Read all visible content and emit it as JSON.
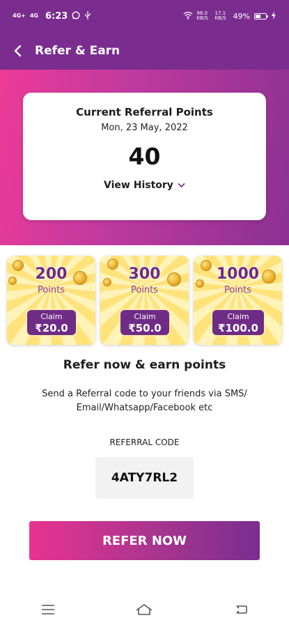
{
  "status_bar": {
    "network_1": "4G+",
    "network_2": "4G",
    "time": "6:23",
    "left_icons": [
      "whatsapp-icon",
      "usb-icon"
    ],
    "right_icons": [
      "wifi-icon"
    ],
    "speed_1": "96.0 KB/S",
    "speed_2": "17.1 KB/S",
    "battery": "49%"
  },
  "app_bar": {
    "title": "Refer & Earn",
    "back_icon": "chevron-left-icon"
  },
  "points_card": {
    "heading": "Current Referral Points",
    "date": "Mon, 23 May, 2022",
    "points": "40",
    "view_history": "View History",
    "accent": "#7a2d8f"
  },
  "rewards": [
    {
      "points": "200",
      "points_label": "Points",
      "claim_label": "Claim",
      "claim_amount": "₹20.0"
    },
    {
      "points": "300",
      "points_label": "Points",
      "claim_label": "Claim",
      "claim_amount": "₹50.0"
    },
    {
      "points": "1000",
      "points_label": "Points",
      "claim_label": "Claim",
      "claim_amount": "₹100.0"
    }
  ],
  "refer": {
    "title": "Refer now & earn points",
    "description": "Send a Referral code to your friends via SMS/ Email/Whatsapp/Facebook etc",
    "code_label": "REFERRAL CODE",
    "code": "4ATY7RL2",
    "button": "REFER NOW"
  },
  "nav_bar": [
    "menu-icon",
    "home-icon",
    "back-icon"
  ],
  "colors": {
    "brand": "#7a2d8f",
    "pink": "#ee3a97",
    "tile_yellow": "#ffe27a"
  }
}
